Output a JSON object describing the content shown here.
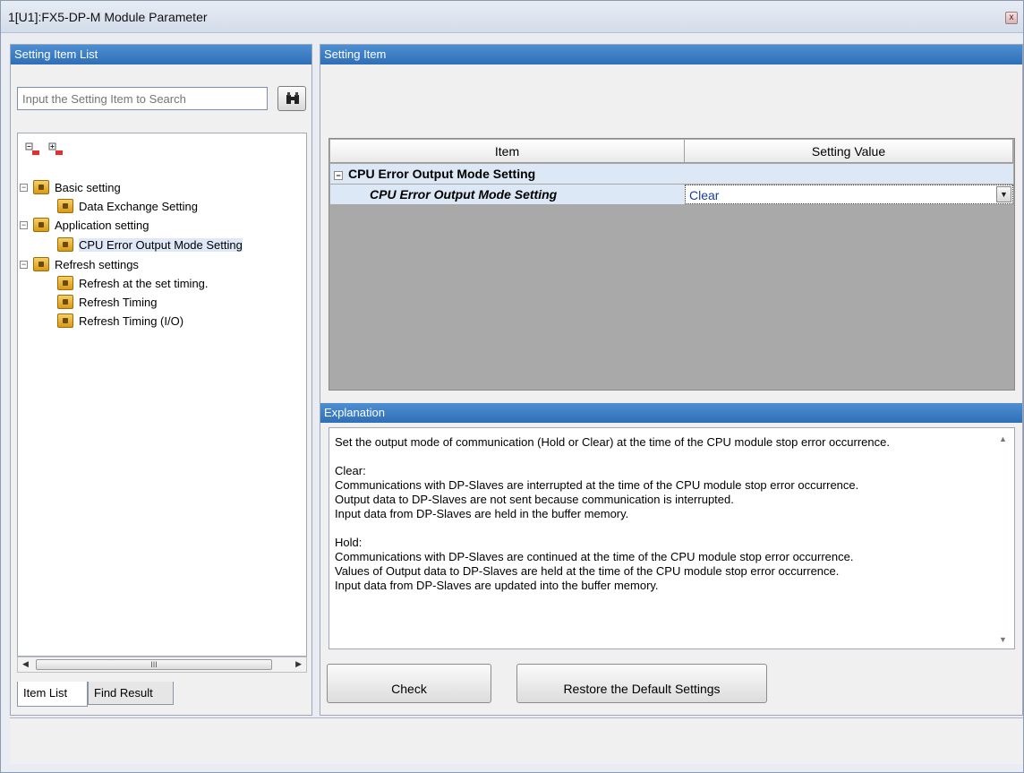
{
  "window": {
    "title": "1[U1]:FX5-DP-M Module Parameter",
    "close_label": "x"
  },
  "left": {
    "header": "Setting Item List",
    "search_placeholder": "Input the Setting Item to Search",
    "tree": [
      {
        "label": "Basic setting",
        "level": 0,
        "expander": "−"
      },
      {
        "label": "Data Exchange Setting",
        "level": 1
      },
      {
        "label": "Application setting",
        "level": 0,
        "expander": "−"
      },
      {
        "label": "CPU Error Output Mode Setting",
        "level": 1,
        "selected": true
      },
      {
        "label": "Refresh settings",
        "level": 0,
        "expander": "−"
      },
      {
        "label": "Refresh at the set timing.",
        "level": 1
      },
      {
        "label": "Refresh Timing",
        "level": 1
      },
      {
        "label": "Refresh Timing (I/O)",
        "level": 1
      }
    ],
    "scroll_thumb_label": "III",
    "tabs": {
      "item_list": "Item List",
      "find_result": "Find Result"
    }
  },
  "right": {
    "header": "Setting Item",
    "grid": {
      "col_item": "Item",
      "col_value": "Setting Value",
      "group_label": "CPU Error Output Mode Setting",
      "row_label": "CPU Error Output Mode Setting",
      "row_value": "Clear"
    },
    "explanation_header": "Explanation",
    "explanation": {
      "p1": "Set the output mode of communication (Hold or Clear) at the time of the CPU module stop error occurrence.",
      "p2": "Clear:\nCommunications with DP-Slaves are interrupted at the time of the CPU module stop error occurrence.\nOutput data to DP-Slaves are not sent because communication is interrupted.\nInput data from DP-Slaves are held in the buffer memory.",
      "p3": "Hold:\nCommunications with DP-Slaves are continued at the time of the CPU module stop error occurrence.\nValues of Output data to DP-Slaves are held at the time of the CPU module stop error occurrence.\nInput data from DP-Slaves are updated into the buffer memory."
    },
    "buttons": {
      "check": "Check",
      "restore": "Restore the Default Settings"
    }
  },
  "colors": {
    "header_blue": "#2f6fb8",
    "selection": "#dce8f6"
  }
}
